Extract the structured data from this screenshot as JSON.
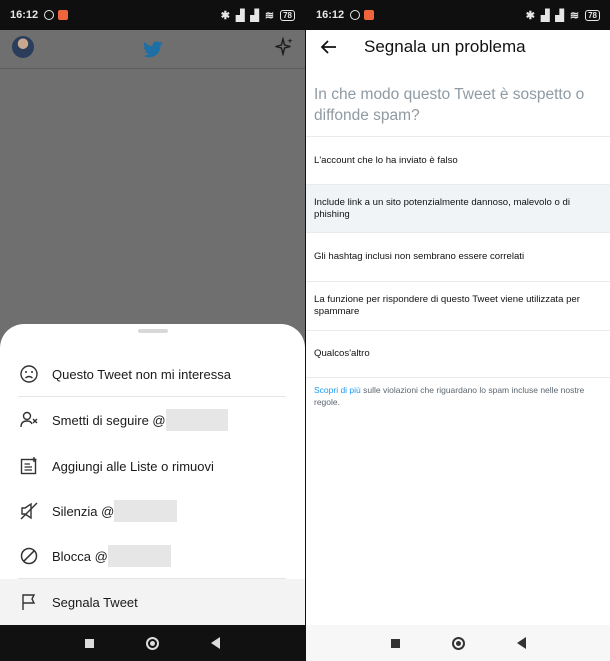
{
  "status": {
    "time": "16:12",
    "battery": "78"
  },
  "colors": {
    "twitter_blue": "#1d9bf0",
    "scrim": "#6f6f6f"
  },
  "left": {
    "sheet_items": [
      {
        "label": "Questo Tweet non mi interessa",
        "icon": "sad-face-icon"
      },
      {
        "label": "Smetti di seguire @",
        "icon": "unfollow-user-icon",
        "redacted": true
      },
      {
        "label": "Aggiungi alle Liste o rimuovi",
        "icon": "list-add-icon"
      },
      {
        "label": "Silenzia @",
        "icon": "mute-icon",
        "redacted": true
      },
      {
        "label": "Blocca @",
        "icon": "block-icon",
        "redacted": true
      },
      {
        "label": "Segnala Tweet",
        "icon": "flag-icon"
      }
    ]
  },
  "right": {
    "title": "Segnala un problema",
    "question": "In che modo questo Tweet è sospetto o diffonde spam?",
    "options": [
      "L'account che lo ha inviato è falso",
      "Include link a un sito potenzialmente dannoso, malevolo o di phishing",
      "Gli hashtag inclusi non sembrano essere correlati",
      "La funzione per rispondere di questo Tweet viene utilizzata per spammare",
      "Qualcos'altro"
    ],
    "footnote_link": "Scopri di più",
    "footnote_text": " sulle violazioni che riguardano lo spam incluse nelle nostre regole."
  }
}
